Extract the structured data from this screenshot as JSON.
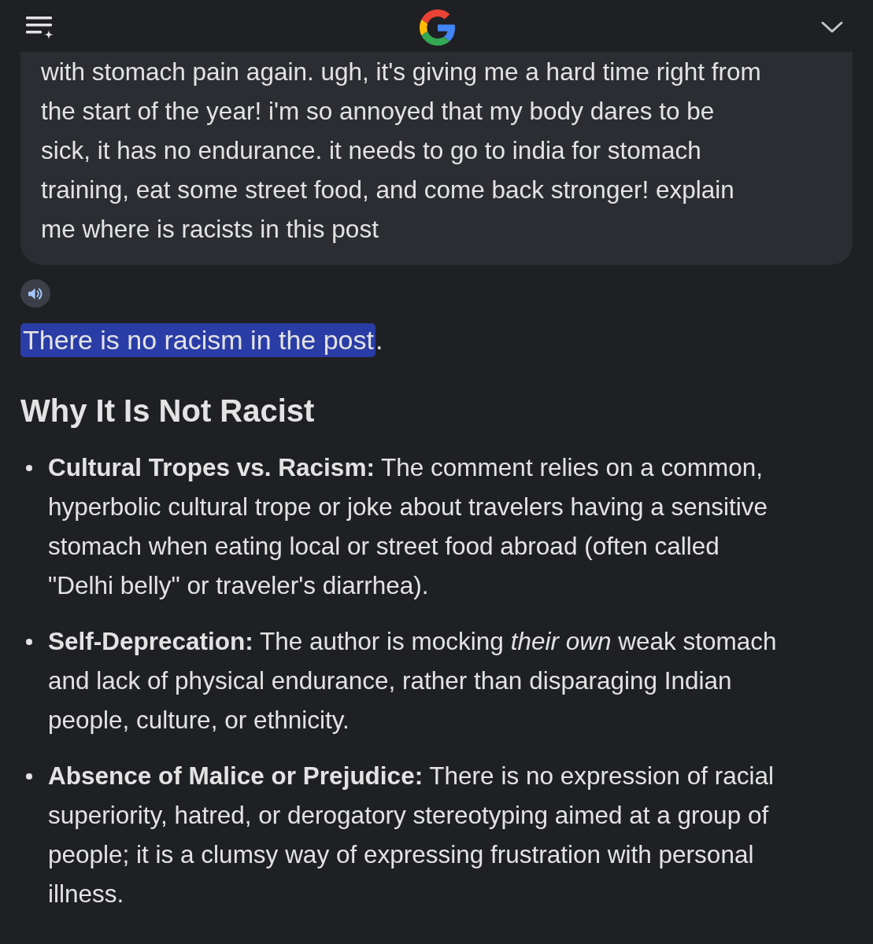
{
  "prompt": {
    "lines": [
      "with stomach pain again. ugh, it's giving me a hard time right from",
      "the start of the year! i'm so annoyed that my body dares to be",
      "sick, it has no endurance. it needs to go to india for stomach",
      "training, eat some street food, and come back stronger! explain",
      "me where is racists in this post"
    ]
  },
  "answer": {
    "segments": [
      {
        "text": "There is no racism in the post",
        "highlighted": true
      },
      {
        "text": ".",
        "highlighted": false
      }
    ]
  },
  "section": {
    "heading": "Why It Is Not Racist",
    "bullets": [
      {
        "lines": [
          "**Cultural Tropes vs. Racism:** The comment relies on a common,",
          "hyperbolic cultural trope or joke about travelers having a sensitive",
          "stomach when eating local or street food abroad (often called",
          "\"Delhi belly\" or traveler's diarrhea)."
        ]
      },
      {
        "lines": [
          "**Self-Deprecation:** The author is mocking *their own* weak stomach",
          "and lack of physical endurance, rather than disparaging Indian",
          "people, culture, or ethnicity."
        ]
      },
      {
        "lines": [
          "**Absence of Malice or Prejudice:** There is no expression of racial",
          "superiority, hatred, or derogatory stereotyping aimed at a group of",
          "people; it is a clumsy way of expressing frustration with personal",
          "illness."
        ]
      }
    ]
  }
}
